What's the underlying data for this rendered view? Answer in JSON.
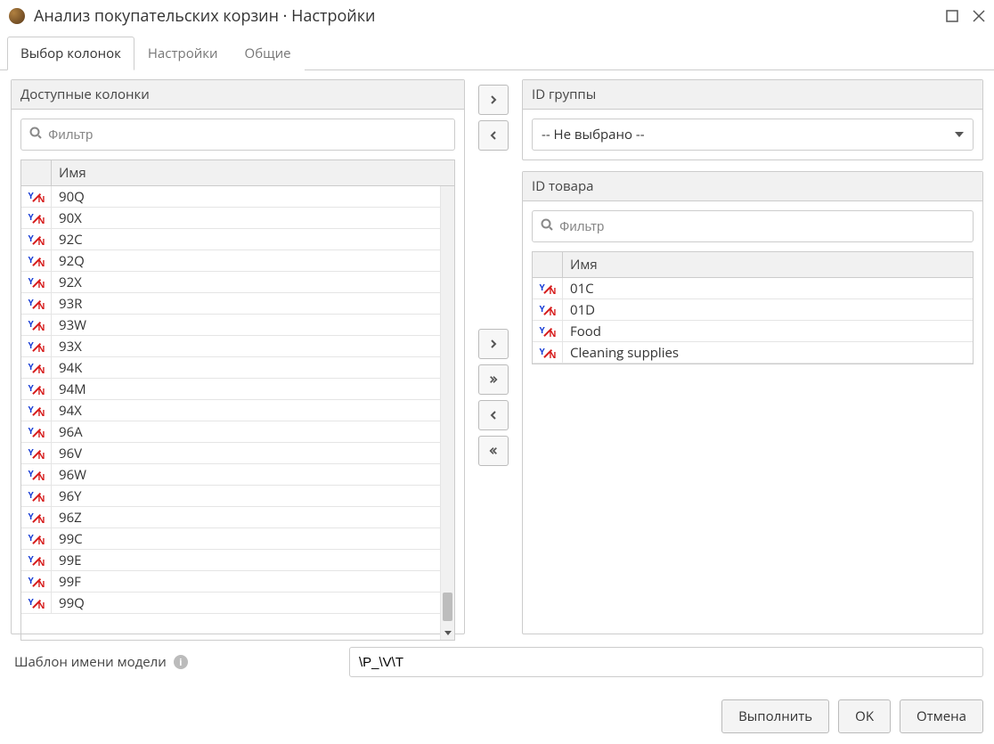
{
  "window": {
    "title": "Анализ покупательских корзин · Настройки"
  },
  "tabs": [
    {
      "label": "Выбор колонок",
      "active": true
    },
    {
      "label": "Настройки",
      "active": false
    },
    {
      "label": "Общие",
      "active": false
    }
  ],
  "left": {
    "title": "Доступные колонки",
    "filter_placeholder": "Фильтр",
    "header": "Имя",
    "rows": [
      "90Q",
      "90X",
      "92C",
      "92Q",
      "92X",
      "93R",
      "93W",
      "93X",
      "94K",
      "94M",
      "94X",
      "96A",
      "96V",
      "96W",
      "96Y",
      "96Z",
      "99C",
      "99E",
      "99F",
      "99Q"
    ]
  },
  "group_panel": {
    "title": "ID группы",
    "selected": "-- Не выбрано --"
  },
  "product_panel": {
    "title": "ID товара",
    "filter_placeholder": "Фильтр",
    "header": "Имя",
    "rows": [
      "01C",
      "01D",
      "Food",
      "Cleaning supplies"
    ]
  },
  "model_name": {
    "label": "Шаблон имени модели",
    "value": "\\P_\\V\\T"
  },
  "footer": {
    "execute": "Выполнить",
    "ok": "OK",
    "cancel": "Отмена"
  }
}
